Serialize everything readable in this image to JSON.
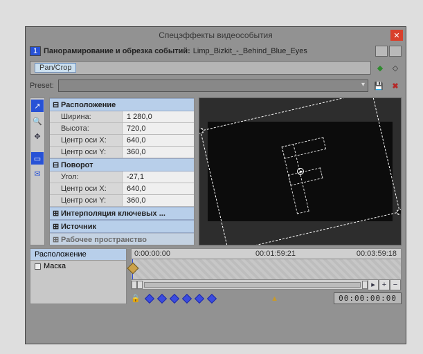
{
  "title": "Спецэффекты видеособытия",
  "close_glyph": "✕",
  "track_number": "1",
  "header_label": "Панорамирование и обрезка событий:",
  "header_file": "Limp_Bizkit_-_Behind_Blue_Eyes",
  "chain_chip": "Pan/Crop",
  "preset_label": "Preset:",
  "save_glyph": "💾",
  "delete_glyph": "✖",
  "groups": {
    "pos": {
      "title": "Расположение",
      "expand": "⊟"
    },
    "rot": {
      "title": "Поворот",
      "expand": "⊟"
    },
    "keys": {
      "title": "Интерполяция ключевых ...",
      "expand": "⊞"
    },
    "src": {
      "title": "Источник",
      "expand": "⊞"
    },
    "ws": {
      "title": "Рабочее пространство",
      "expand": "⊞"
    }
  },
  "props": {
    "width_k": "Ширина:",
    "width_v": "1 280,0",
    "height_k": "Высота:",
    "height_v": "720,0",
    "cx_k": "Центр оси X:",
    "cx_v": "640,0",
    "cy_k": "Центр оси Y:",
    "cy_v": "360,0",
    "angle_k": "Угол:",
    "angle_v": "-27,1",
    "rcx_k": "Центр оси X:",
    "rcx_v": "640,0",
    "rcy_k": "Центр оси Y:",
    "rcy_v": "360,0"
  },
  "ruler": {
    "t0": "0:00:00:00",
    "t1": "00:01:59:21",
    "t2": "00:03:59:18"
  },
  "tracklist": {
    "position": "Расположение",
    "mask": "Маска"
  },
  "timecode": "00:00:00:00",
  "icons": {
    "plugin": "⊞",
    "fx": "fx",
    "ab": "↔",
    "arrow": "↗",
    "zoom": "🔍",
    "hand": "✥",
    "screen": "▭",
    "env": "✉",
    "play": "▸",
    "plus": "+",
    "minus": "−",
    "flag": "▲",
    "lock": "🔒"
  }
}
